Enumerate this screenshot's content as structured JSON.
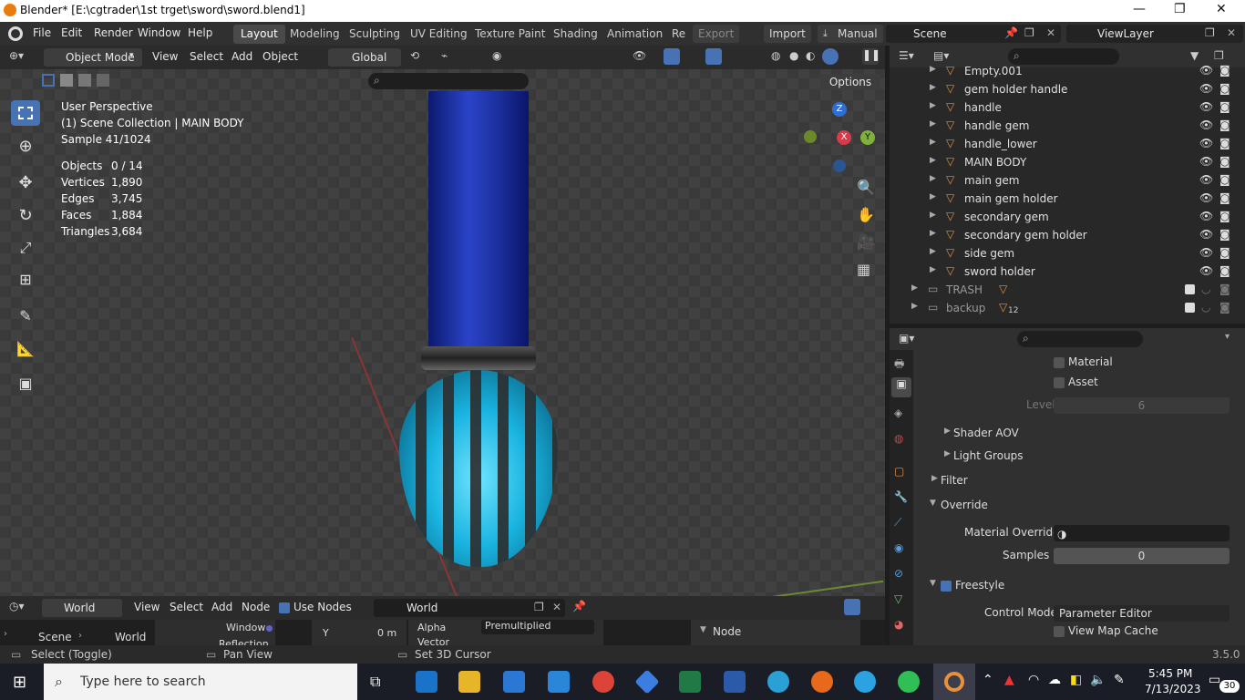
{
  "window": {
    "title": "Blender* [E:\\cgtrader\\1st trget\\sword\\sword.blend1]",
    "minimize": "—",
    "restore": "❐",
    "close": "✕"
  },
  "menubar": {
    "items": [
      "File",
      "Edit",
      "Render",
      "Window",
      "Help"
    ],
    "workspaces": [
      "Layout",
      "Modeling",
      "Sculpting",
      "UV Editing",
      "Texture Paint",
      "Shading",
      "Animation",
      "Re"
    ],
    "active_workspace": "Layout",
    "export_label": "Export",
    "import_label": "Import",
    "manual_label": "Manual",
    "scene": "Scene",
    "view_layer": "ViewLayer"
  },
  "viewport": {
    "mode": "Object Mode",
    "menus": [
      "View",
      "Select",
      "Add",
      "Object"
    ],
    "orientation": "Global",
    "options_label": "Options",
    "info_line1": "User Perspective",
    "info_line2": "(1) Scene Collection | MAIN BODY",
    "info_line3": "Sample 41/1024",
    "stats": [
      {
        "label": "Objects",
        "value": "0 / 14"
      },
      {
        "label": "Vertices",
        "value": "1,890"
      },
      {
        "label": "Edges",
        "value": "3,745"
      },
      {
        "label": "Faces",
        "value": "1,884"
      },
      {
        "label": "Triangles",
        "value": "3,684"
      }
    ],
    "gizmo_axes": {
      "z": "Z",
      "x": "X",
      "y": "Y"
    }
  },
  "outliner": {
    "items": [
      {
        "name": "Empty.001"
      },
      {
        "name": "gem holder handle"
      },
      {
        "name": "handle"
      },
      {
        "name": "handle gem"
      },
      {
        "name": "handle_lower"
      },
      {
        "name": "MAIN BODY"
      },
      {
        "name": "main gem"
      },
      {
        "name": "main gem holder"
      },
      {
        "name": "secondary gem"
      },
      {
        "name": "secondary gem holder"
      },
      {
        "name": "side gem"
      },
      {
        "name": "sword holder"
      }
    ],
    "collections": [
      {
        "name": "TRASH",
        "badge": ""
      },
      {
        "name": "backup",
        "badge": "12"
      }
    ]
  },
  "properties": {
    "material_label": "Material",
    "asset_label": "Asset",
    "levels_label": "Levels",
    "levels_value": "6",
    "shader_aov": "Shader AOV",
    "light_groups": "Light Groups",
    "filter": "Filter",
    "override": "Override",
    "material_override_label": "Material Override",
    "samples_label": "Samples",
    "samples_value": "0",
    "freestyle": "Freestyle",
    "control_mode_label": "Control Mode",
    "control_mode_value": "Parameter Editor",
    "view_map_cache": "View Map Cache"
  },
  "shader_editor": {
    "menus": [
      "View",
      "Select",
      "Add",
      "Node"
    ],
    "type": "World",
    "use_nodes": "Use Nodes",
    "world_name": "World",
    "breadcrumb_scene": "Scene",
    "breadcrumb_world": "World",
    "window_label": "Window",
    "y_label": "Y",
    "y_value": "0 m",
    "alpha_label": "Alpha",
    "alpha_value": "Premultiplied",
    "vector_label": "Vector",
    "reflection_label": "Reflection",
    "node_panel": "Node"
  },
  "statusbar": {
    "select": "Select (Toggle)",
    "pan": "Pan View",
    "cursor": "Set 3D Cursor",
    "version": "3.5.0"
  },
  "taskbar": {
    "search_placeholder": "Type here to search",
    "time": "5:45 PM",
    "date": "7/13/2023",
    "notif_count": "30"
  }
}
